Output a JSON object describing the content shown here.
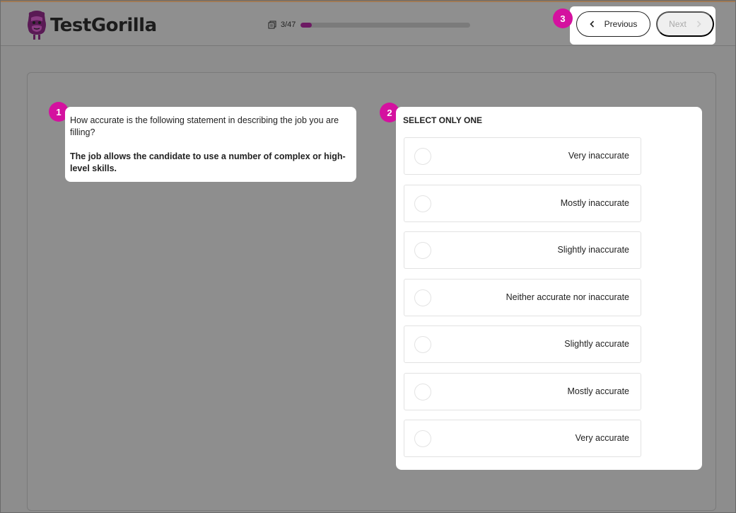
{
  "app": {
    "logo_text": "TestGorilla"
  },
  "progress": {
    "label": "3/47",
    "current": 3,
    "total": 47,
    "percent": 6.4,
    "fill_color": "#6d1a63"
  },
  "nav": {
    "previous_label": "Previous",
    "next_label": "Next"
  },
  "badges": {
    "question": "1",
    "answers": "2",
    "navigation": "3",
    "color": "#d4119f"
  },
  "question": {
    "prompt": "How accurate is the following statement in describing the job you are filling?",
    "statement": "The job allows the candidate to use a number of complex or high-level skills."
  },
  "answers": {
    "heading": "SELECT ONLY ONE",
    "options": [
      {
        "label": "Very inaccurate"
      },
      {
        "label": "Mostly inaccurate"
      },
      {
        "label": "Slightly inaccurate"
      },
      {
        "label": "Neither accurate nor inaccurate"
      },
      {
        "label": "Slightly accurate"
      },
      {
        "label": "Mostly accurate"
      },
      {
        "label": "Very accurate"
      }
    ]
  }
}
